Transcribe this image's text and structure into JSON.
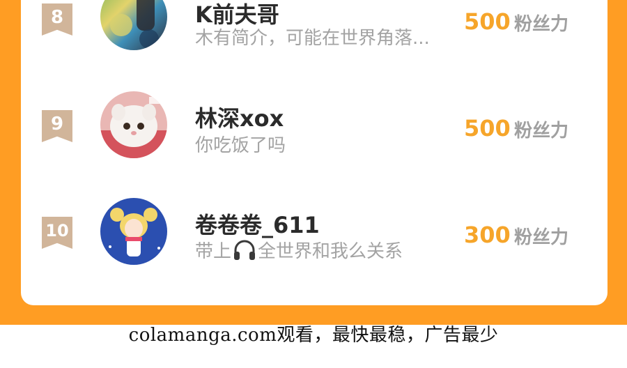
{
  "leaderboard": {
    "entries": [
      {
        "rank": "8",
        "name": "K前夫哥",
        "bio": "木有简介，可能在世界角落...",
        "fans": "500",
        "fans_unit": "粉丝力",
        "avatar": "abstract-photo-avatar"
      },
      {
        "rank": "9",
        "name": "林深xox",
        "bio": "你吃饭了吗",
        "fans": "500",
        "fans_unit": "粉丝力",
        "avatar": "white-cat-avatar"
      },
      {
        "rank": "10",
        "name": "卷卷卷_611",
        "bio_before": "带上",
        "bio_icon": "headphones-icon",
        "bio_after": "全世界和我么关系",
        "fans": "300",
        "fans_unit": "粉丝力",
        "avatar": "anime-girl-avatar"
      }
    ]
  },
  "colors": {
    "background": "#ff9d23",
    "card": "#ffffff",
    "rank_badge": "#d1b59a",
    "fans_number": "#f6a52a"
  },
  "footer": {
    "watermark": "colamanga.com观看，最快最稳，广告最少"
  }
}
